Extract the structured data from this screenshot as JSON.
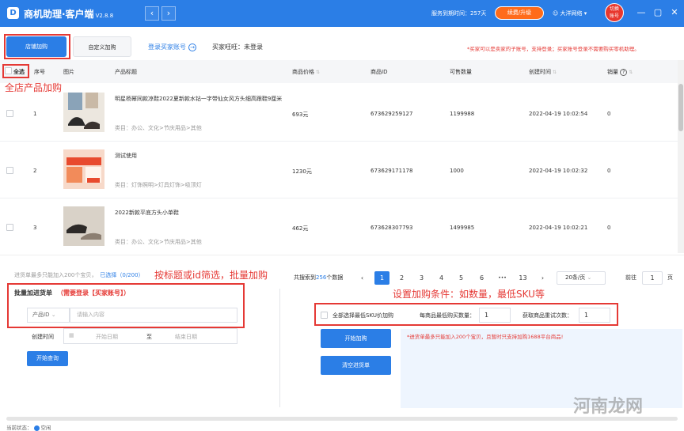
{
  "app": {
    "logo_text": "D",
    "title": "商机助理·客户端",
    "version": "V2.8.8",
    "nav_back": "‹",
    "nav_forward": "›",
    "service_days": "服务到期时间：257天",
    "renew_button": "续费/升级",
    "user": "大洋网络",
    "switch_account": [
      "切换",
      "账号"
    ],
    "window_controls": [
      "—",
      "▢",
      "✕"
    ]
  },
  "annotations": {
    "shop_all": "全店产品加购",
    "filter_batch": "按标题或id筛选，批量加购",
    "conditions": "设置加购条件：如数量，最低SKU等"
  },
  "tabs": [
    {
      "label": "店铺加购",
      "active": true
    },
    {
      "label": "自定义加购",
      "active": false
    }
  ],
  "login_link": "登录买家账号",
  "buyer_wangwang": "买家旺旺：未登录",
  "notice": "*买家可以是卖家的子账号，支持登录；买家账号登录不需要购买零机助理。",
  "table": {
    "headers": {
      "select_all": "全选",
      "index": "序号",
      "image": "图片",
      "title": "产品标题",
      "price": "商品价格",
      "id": "商品ID",
      "stock": "可售数量",
      "created": "创建时间",
      "sales": "销量"
    },
    "rows": [
      {
        "index": "1",
        "title": "明星杨幂同款凉鞋2022夏新款水钻一字带仙女风方头细高跟鞋9厘米",
        "category": "类目：办公、文化>节庆用品>其他",
        "price": "693元",
        "id": "673629259127",
        "stock": "1199988",
        "created": "2022-04-19 10:02:54",
        "sales": "0"
      },
      {
        "index": "2",
        "title": "测试使用",
        "category": "类目：灯饰照明>灯具灯饰>吸顶灯",
        "price": "1230元",
        "id": "673629171178",
        "stock": "1000",
        "created": "2022-04-19 10:02:32",
        "sales": "0"
      },
      {
        "index": "3",
        "title": "2022新款平底方头小单鞋",
        "category": "类目：办公、文化>节庆用品>其他",
        "price": "462元",
        "id": "673628307793",
        "stock": "1499985",
        "created": "2022-04-19 10:02:21",
        "sales": "0"
      }
    ]
  },
  "cart": {
    "hint": "进货单最多只能加入200个宝贝，",
    "selected": "已选择（0/200）"
  },
  "pager": {
    "total_prefix": "共搜索到",
    "total": "256",
    "total_suffix": "个数据",
    "pages": [
      "1",
      "2",
      "3",
      "4",
      "5",
      "6",
      "•••",
      "13"
    ],
    "page_size": "20条/页",
    "goto_label": "前往",
    "goto_value": "1",
    "goto_suffix": "页"
  },
  "batch": {
    "title": "批量加进货单",
    "requirement": "（需要登录【买家账号】）",
    "select": "产品ID",
    "placeholder": "请输入内容",
    "date_label": "创建时间",
    "start_date": "开始日期",
    "date_sep": "至",
    "end_date": "结束日期",
    "query_button": "开始查询"
  },
  "options": {
    "min_sku": "全部选择最低SKU价加购",
    "qty_label": "每商品最低购买数量：",
    "qty_value": "1",
    "retry_label": "获取商品重试次数：",
    "retry_value": "1",
    "start_button": "开始加购",
    "clear_button": "清空进货单",
    "warning": "*进货单最多只能加入200个宝贝，且暂时只支持加购1688平台商品!"
  },
  "status": {
    "label": "当前状态：",
    "value": "空闲"
  },
  "watermark": "河南龙网"
}
